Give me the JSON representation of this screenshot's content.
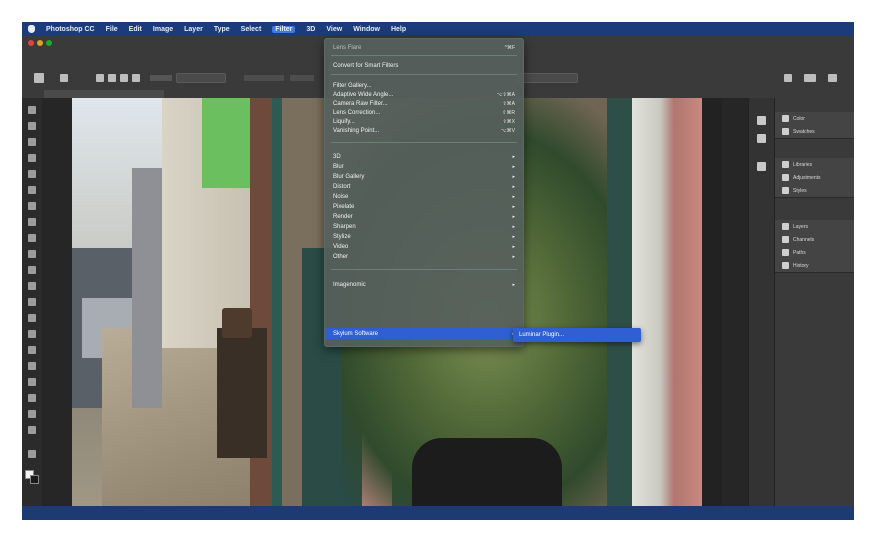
{
  "app": {
    "menubar": [
      "Photoshop CC",
      "File",
      "Edit",
      "Image",
      "Layer",
      "Type",
      "Select",
      "Filter",
      "3D",
      "View",
      "Window",
      "Help"
    ],
    "active_menu": "Filter"
  },
  "filter_menu": {
    "header": "Lens Flare",
    "header_shortcut": "^⌘F",
    "convert": "Convert for Smart Filters",
    "group1": [
      {
        "label": "Filter Gallery...",
        "shortcut": ""
      },
      {
        "label": "Adaptive Wide Angle...",
        "shortcut": "⌥⇧⌘A"
      },
      {
        "label": "Camera Raw Filter...",
        "shortcut": "⇧⌘A"
      },
      {
        "label": "Lens Correction...",
        "shortcut": "⇧⌘R"
      },
      {
        "label": "Liquify...",
        "shortcut": "⇧⌘X"
      },
      {
        "label": "Vanishing Point...",
        "shortcut": "⌥⌘V"
      }
    ],
    "group2": [
      "3D",
      "Blur",
      "Blur Gallery",
      "Distort",
      "Noise",
      "Pixelate",
      "Render",
      "Sharpen",
      "Stylize",
      "Video",
      "Other"
    ],
    "group3": [
      "Imagenomic",
      "Skylum Software"
    ],
    "highlighted": "Skylum Software",
    "submenu_item": "Luminar Plugin..."
  },
  "panels": {
    "group1": [
      "Color",
      "Swatches"
    ],
    "group2": [
      "Libraries",
      "Adjustments",
      "Styles"
    ],
    "group3": [
      "Layers",
      "Channels",
      "Paths",
      "History"
    ]
  },
  "colors": {
    "menubar": "#1c3b7a",
    "highlight": "#2f5fd2",
    "menu_bg": "#56605c"
  }
}
